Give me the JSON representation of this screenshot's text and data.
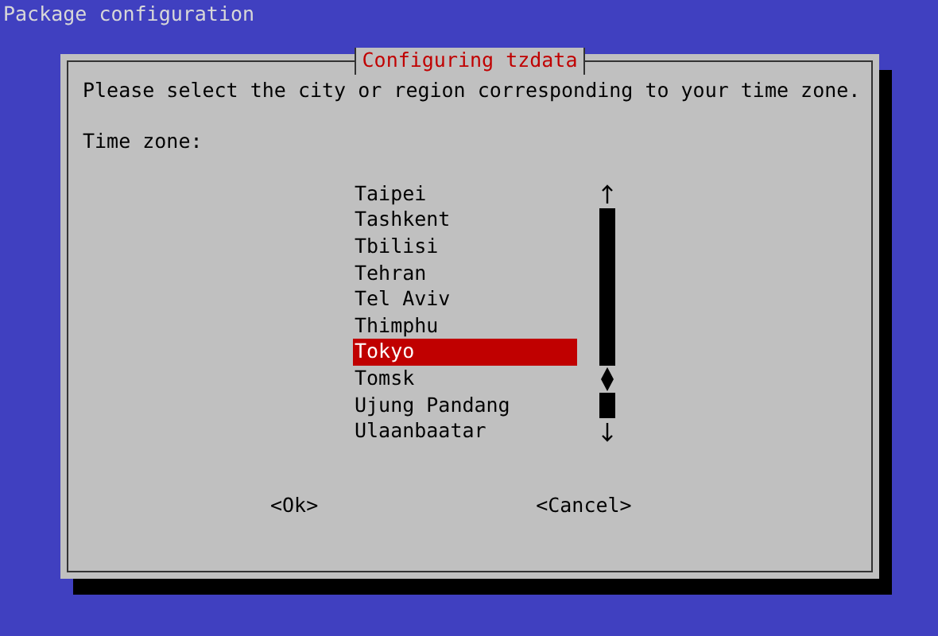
{
  "screen_title": "Package configuration",
  "dialog": {
    "title": "Configuring tzdata",
    "prompt": "Please select the city or region corresponding to your time zone.",
    "list_label": "Time zone:",
    "items": [
      {
        "label": "Taipei",
        "selected": false
      },
      {
        "label": "Tashkent",
        "selected": false
      },
      {
        "label": "Tbilisi",
        "selected": false
      },
      {
        "label": "Tehran",
        "selected": false
      },
      {
        "label": "Tel Aviv",
        "selected": false
      },
      {
        "label": "Thimphu",
        "selected": false
      },
      {
        "label": "Tokyo",
        "selected": true
      },
      {
        "label": "Tomsk",
        "selected": false
      },
      {
        "label": "Ujung Pandang",
        "selected": false
      },
      {
        "label": "Ulaanbaatar",
        "selected": false
      }
    ],
    "buttons": [
      "<Ok>",
      "<Cancel>"
    ]
  }
}
